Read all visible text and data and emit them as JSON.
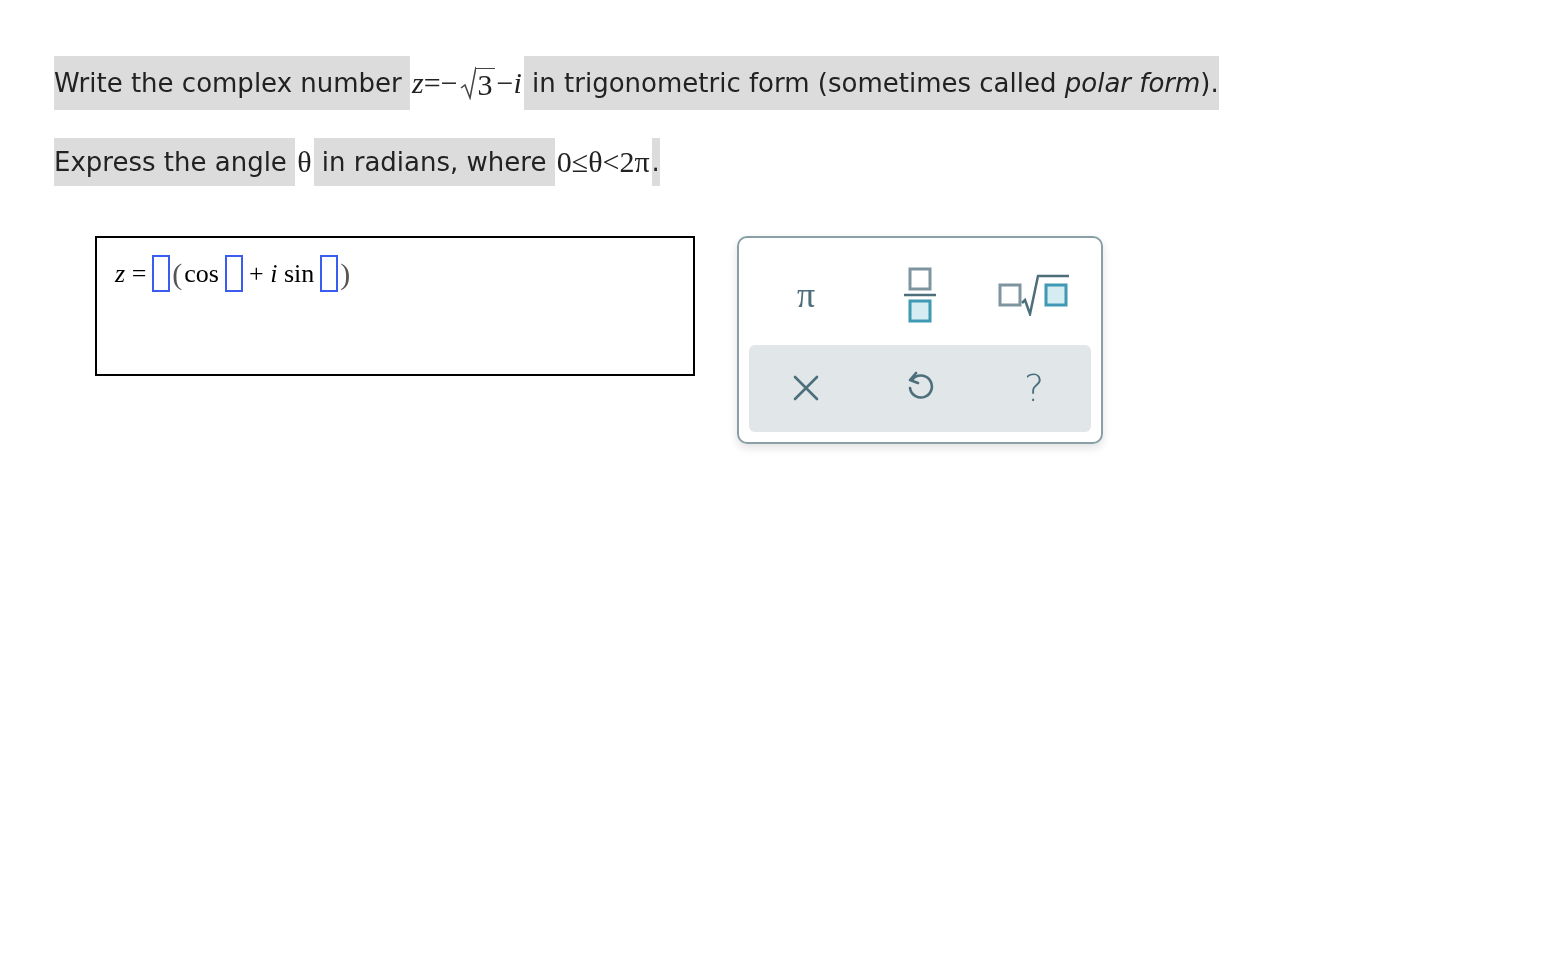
{
  "question": {
    "lines": [
      {
        "segments": [
          {
            "kind": "text",
            "text": "Write the complex number "
          },
          {
            "kind": "math",
            "text": "*z*=−"
          },
          {
            "kind": "sqrt",
            "text": "3"
          },
          {
            "kind": "math",
            "text": "−*i*"
          },
          {
            "kind": "text",
            "text": " in trigonometric form (sometimes called *polar form*)."
          }
        ]
      },
      {
        "segments": [
          {
            "kind": "text",
            "text": "Express the angle "
          },
          {
            "kind": "math",
            "text": "θ"
          },
          {
            "kind": "text",
            "text": " in radians, where "
          },
          {
            "kind": "math",
            "text": "0≤θ<2π"
          },
          {
            "kind": "text",
            "text": "."
          }
        ]
      }
    ]
  },
  "answer": {
    "tokens": [
      {
        "kind": "math",
        "text": "*z* ="
      },
      {
        "kind": "blank"
      },
      {
        "kind": "paren",
        "text": "("
      },
      {
        "kind": "math",
        "text": "cos"
      },
      {
        "kind": "blank"
      },
      {
        "kind": "math",
        "text": "+ *i* sin"
      },
      {
        "kind": "blank"
      },
      {
        "kind": "paren",
        "text": ")"
      }
    ]
  },
  "keypad": {
    "keys": [
      {
        "kind": "symbol",
        "text": "π"
      },
      {
        "kind": "fraction"
      },
      {
        "kind": "nth-root"
      }
    ],
    "actions": [
      {
        "kind": "clear"
      },
      {
        "kind": "undo"
      },
      {
        "kind": "help",
        "text": "?"
      }
    ]
  }
}
